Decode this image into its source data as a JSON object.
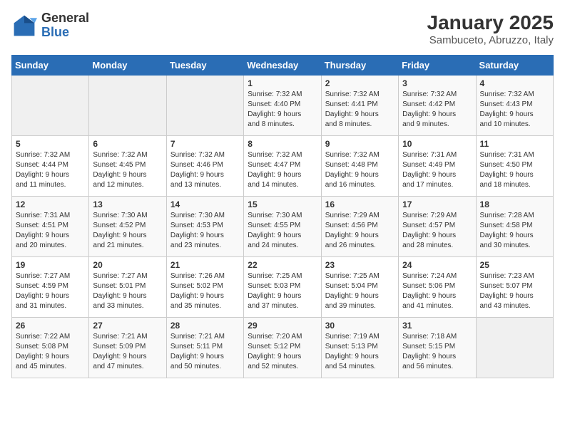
{
  "header": {
    "logo": {
      "general": "General",
      "blue": "Blue"
    },
    "title": "January 2025",
    "location": "Sambuceto, Abruzzo, Italy"
  },
  "days_of_week": [
    "Sunday",
    "Monday",
    "Tuesday",
    "Wednesday",
    "Thursday",
    "Friday",
    "Saturday"
  ],
  "weeks": [
    [
      {
        "day": "",
        "info": ""
      },
      {
        "day": "",
        "info": ""
      },
      {
        "day": "",
        "info": ""
      },
      {
        "day": "1",
        "info": "Sunrise: 7:32 AM\nSunset: 4:40 PM\nDaylight: 9 hours\nand 8 minutes."
      },
      {
        "day": "2",
        "info": "Sunrise: 7:32 AM\nSunset: 4:41 PM\nDaylight: 9 hours\nand 8 minutes."
      },
      {
        "day": "3",
        "info": "Sunrise: 7:32 AM\nSunset: 4:42 PM\nDaylight: 9 hours\nand 9 minutes."
      },
      {
        "day": "4",
        "info": "Sunrise: 7:32 AM\nSunset: 4:43 PM\nDaylight: 9 hours\nand 10 minutes."
      }
    ],
    [
      {
        "day": "5",
        "info": "Sunrise: 7:32 AM\nSunset: 4:44 PM\nDaylight: 9 hours\nand 11 minutes."
      },
      {
        "day": "6",
        "info": "Sunrise: 7:32 AM\nSunset: 4:45 PM\nDaylight: 9 hours\nand 12 minutes."
      },
      {
        "day": "7",
        "info": "Sunrise: 7:32 AM\nSunset: 4:46 PM\nDaylight: 9 hours\nand 13 minutes."
      },
      {
        "day": "8",
        "info": "Sunrise: 7:32 AM\nSunset: 4:47 PM\nDaylight: 9 hours\nand 14 minutes."
      },
      {
        "day": "9",
        "info": "Sunrise: 7:32 AM\nSunset: 4:48 PM\nDaylight: 9 hours\nand 16 minutes."
      },
      {
        "day": "10",
        "info": "Sunrise: 7:31 AM\nSunset: 4:49 PM\nDaylight: 9 hours\nand 17 minutes."
      },
      {
        "day": "11",
        "info": "Sunrise: 7:31 AM\nSunset: 4:50 PM\nDaylight: 9 hours\nand 18 minutes."
      }
    ],
    [
      {
        "day": "12",
        "info": "Sunrise: 7:31 AM\nSunset: 4:51 PM\nDaylight: 9 hours\nand 20 minutes."
      },
      {
        "day": "13",
        "info": "Sunrise: 7:30 AM\nSunset: 4:52 PM\nDaylight: 9 hours\nand 21 minutes."
      },
      {
        "day": "14",
        "info": "Sunrise: 7:30 AM\nSunset: 4:53 PM\nDaylight: 9 hours\nand 23 minutes."
      },
      {
        "day": "15",
        "info": "Sunrise: 7:30 AM\nSunset: 4:55 PM\nDaylight: 9 hours\nand 24 minutes."
      },
      {
        "day": "16",
        "info": "Sunrise: 7:29 AM\nSunset: 4:56 PM\nDaylight: 9 hours\nand 26 minutes."
      },
      {
        "day": "17",
        "info": "Sunrise: 7:29 AM\nSunset: 4:57 PM\nDaylight: 9 hours\nand 28 minutes."
      },
      {
        "day": "18",
        "info": "Sunrise: 7:28 AM\nSunset: 4:58 PM\nDaylight: 9 hours\nand 30 minutes."
      }
    ],
    [
      {
        "day": "19",
        "info": "Sunrise: 7:27 AM\nSunset: 4:59 PM\nDaylight: 9 hours\nand 31 minutes."
      },
      {
        "day": "20",
        "info": "Sunrise: 7:27 AM\nSunset: 5:01 PM\nDaylight: 9 hours\nand 33 minutes."
      },
      {
        "day": "21",
        "info": "Sunrise: 7:26 AM\nSunset: 5:02 PM\nDaylight: 9 hours\nand 35 minutes."
      },
      {
        "day": "22",
        "info": "Sunrise: 7:25 AM\nSunset: 5:03 PM\nDaylight: 9 hours\nand 37 minutes."
      },
      {
        "day": "23",
        "info": "Sunrise: 7:25 AM\nSunset: 5:04 PM\nDaylight: 9 hours\nand 39 minutes."
      },
      {
        "day": "24",
        "info": "Sunrise: 7:24 AM\nSunset: 5:06 PM\nDaylight: 9 hours\nand 41 minutes."
      },
      {
        "day": "25",
        "info": "Sunrise: 7:23 AM\nSunset: 5:07 PM\nDaylight: 9 hours\nand 43 minutes."
      }
    ],
    [
      {
        "day": "26",
        "info": "Sunrise: 7:22 AM\nSunset: 5:08 PM\nDaylight: 9 hours\nand 45 minutes."
      },
      {
        "day": "27",
        "info": "Sunrise: 7:21 AM\nSunset: 5:09 PM\nDaylight: 9 hours\nand 47 minutes."
      },
      {
        "day": "28",
        "info": "Sunrise: 7:21 AM\nSunset: 5:11 PM\nDaylight: 9 hours\nand 50 minutes."
      },
      {
        "day": "29",
        "info": "Sunrise: 7:20 AM\nSunset: 5:12 PM\nDaylight: 9 hours\nand 52 minutes."
      },
      {
        "day": "30",
        "info": "Sunrise: 7:19 AM\nSunset: 5:13 PM\nDaylight: 9 hours\nand 54 minutes."
      },
      {
        "day": "31",
        "info": "Sunrise: 7:18 AM\nSunset: 5:15 PM\nDaylight: 9 hours\nand 56 minutes."
      },
      {
        "day": "",
        "info": ""
      }
    ]
  ]
}
